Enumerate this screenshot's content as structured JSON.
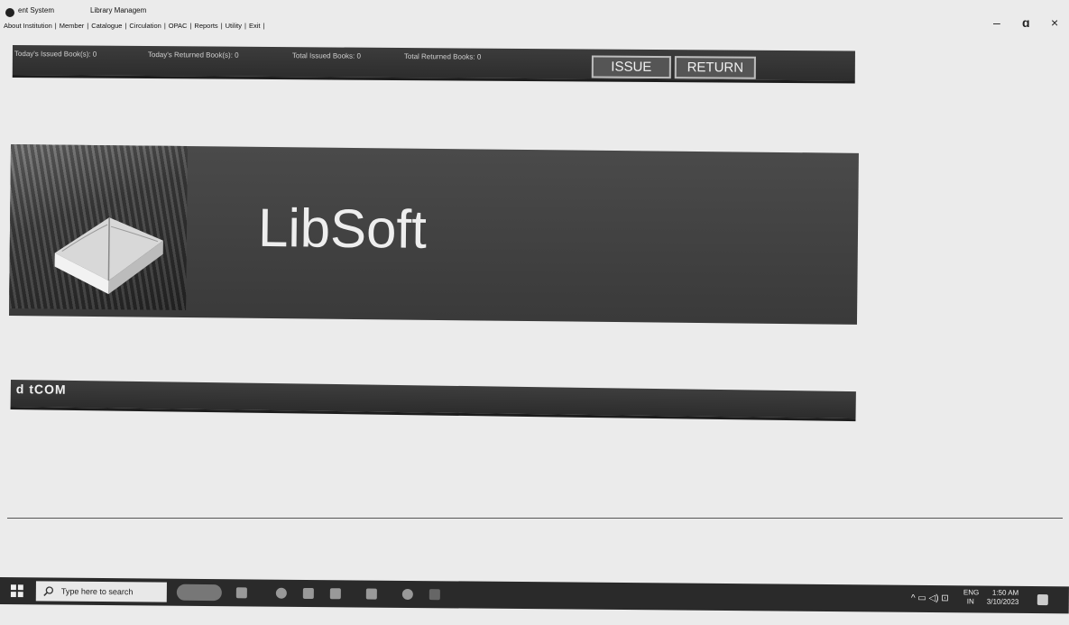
{
  "window": {
    "title_left": "ent System",
    "title_right": "Library Managem",
    "controls": {
      "minimize": "–",
      "maximize": "ɑ",
      "close": "×"
    }
  },
  "menu": {
    "items": [
      {
        "label": "About Institution"
      },
      {
        "label": "Member"
      },
      {
        "label": "Catalogue"
      },
      {
        "label": "Circulation"
      },
      {
        "label": "OPAC"
      },
      {
        "label": "Reports"
      },
      {
        "label": "Utility"
      },
      {
        "label": "Exit"
      }
    ],
    "separator": "|"
  },
  "status": {
    "todays_issued": "Today's Issued Book(s): 0",
    "todays_returned": "Today's Returned Book(s): 0",
    "total_issued": "Total Issued Books: 0",
    "total_returned": "Total Returned Books: 0"
  },
  "actions": {
    "issue": "ISSUE",
    "return": "RETURN"
  },
  "banner": {
    "title": "LibSoft"
  },
  "strip2": {
    "label": "d tCOM"
  },
  "taskbar": {
    "search_placeholder": "Type here to search",
    "tray_lang_1": "ENG",
    "tray_lang_2": "IN",
    "time": "1:50 AM",
    "date": "3/10/2023"
  },
  "colors": {
    "bar": "#2d2d2d",
    "banner": "#444444",
    "background": "#ebebeb"
  }
}
